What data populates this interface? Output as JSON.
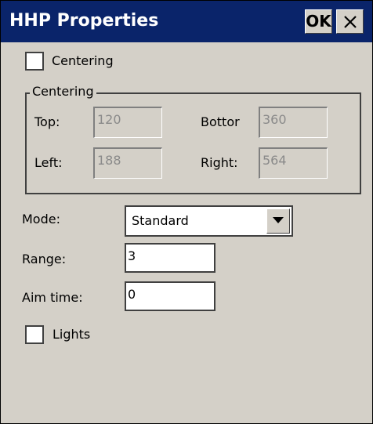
{
  "window": {
    "title": "HHP Properties",
    "ok_label": "OK",
    "close_icon": "close-icon"
  },
  "centering_checkbox": {
    "label": "Centering",
    "checked": false
  },
  "centering_group": {
    "legend": "Centering",
    "top_label": "Top:",
    "top_value": "120",
    "bottom_label": "Bottor",
    "bottom_value": "360",
    "left_label": "Left:",
    "left_value": "188",
    "right_label": "Right:",
    "right_value": "564"
  },
  "mode": {
    "label": "Mode:",
    "value": "Standard"
  },
  "range": {
    "label": "Range:",
    "value": "3"
  },
  "aim_time": {
    "label": "Aim time:",
    "value": "0"
  },
  "lights_checkbox": {
    "label": "Lights",
    "checked": false
  },
  "colors": {
    "titlebar": "#0a246a",
    "dialog_bg": "#d4d0c8"
  }
}
